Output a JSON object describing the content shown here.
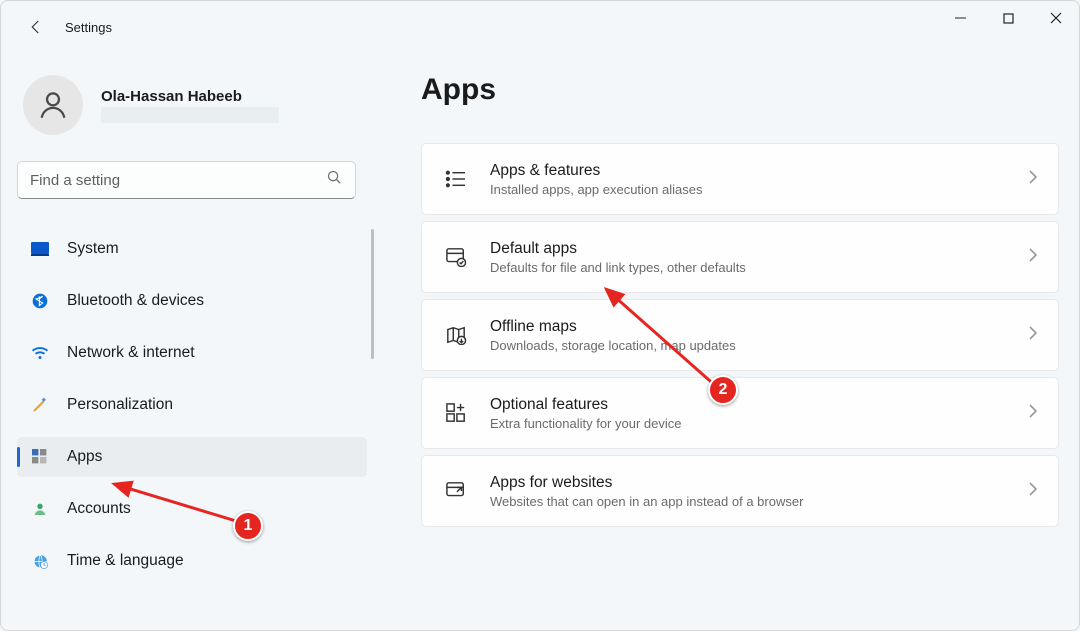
{
  "window": {
    "title": "Settings"
  },
  "user": {
    "name": "Ola-Hassan Habeeb"
  },
  "search": {
    "placeholder": "Find a setting"
  },
  "sidebar": {
    "items": [
      {
        "label": "System",
        "icon": "system-icon"
      },
      {
        "label": "Bluetooth & devices",
        "icon": "bluetooth-icon"
      },
      {
        "label": "Network & internet",
        "icon": "wifi-icon"
      },
      {
        "label": "Personalization",
        "icon": "personalization-icon"
      },
      {
        "label": "Apps",
        "icon": "apps-icon",
        "selected": true
      },
      {
        "label": "Accounts",
        "icon": "accounts-icon"
      },
      {
        "label": "Time & language",
        "icon": "time-language-icon"
      }
    ]
  },
  "page": {
    "heading": "Apps",
    "cards": [
      {
        "title": "Apps & features",
        "sub": "Installed apps, app execution aliases"
      },
      {
        "title": "Default apps",
        "sub": "Defaults for file and link types, other defaults"
      },
      {
        "title": "Offline maps",
        "sub": "Downloads, storage location, map updates"
      },
      {
        "title": "Optional features",
        "sub": "Extra functionality for your device"
      },
      {
        "title": "Apps for websites",
        "sub": "Websites that can open in an app instead of a browser"
      }
    ]
  },
  "annotations": {
    "badge1": "1",
    "badge2": "2"
  }
}
